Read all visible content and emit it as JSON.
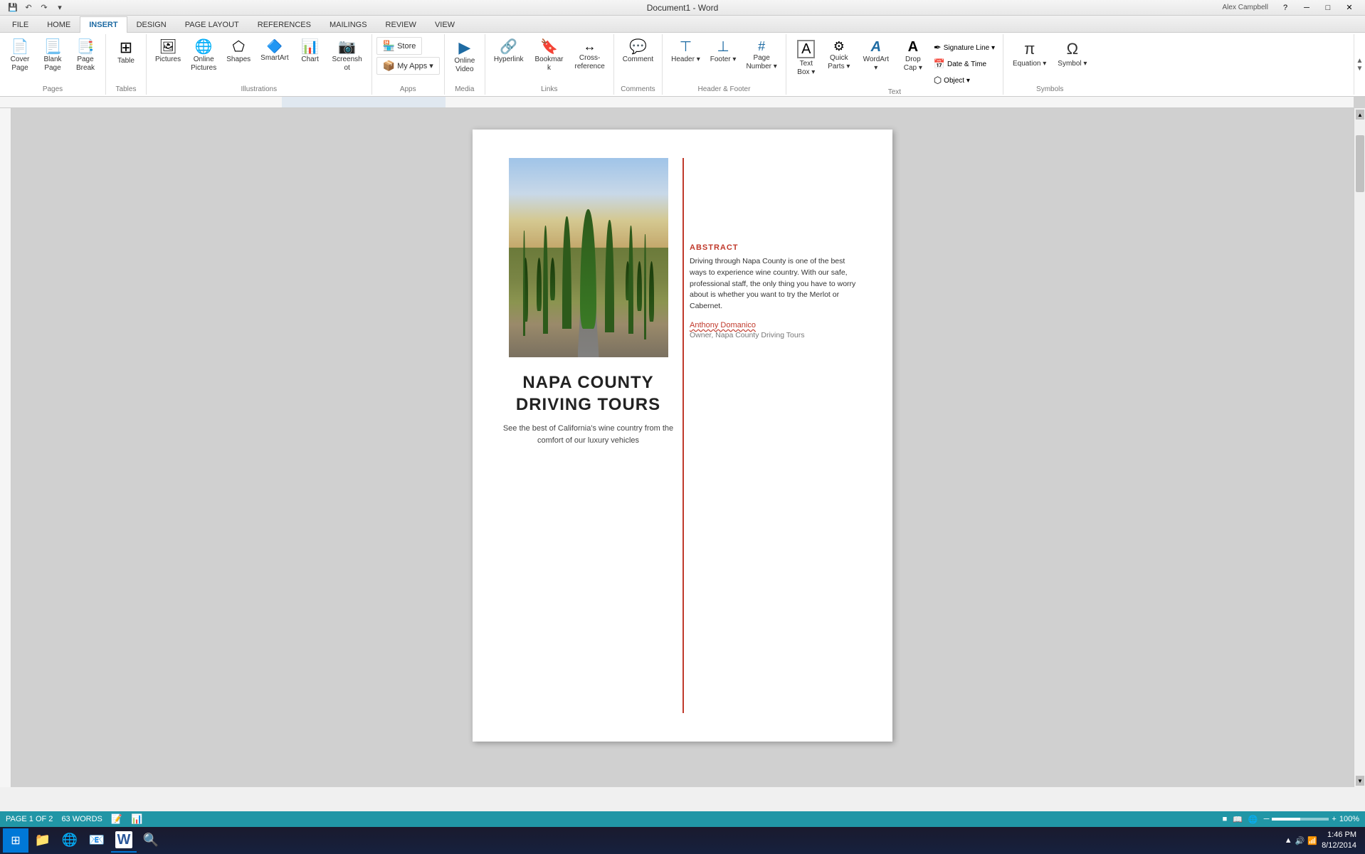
{
  "titlebar": {
    "title": "Document1 - Word",
    "minimize": "─",
    "maximize": "□",
    "close": "✕",
    "user": "Alex Campbell"
  },
  "qat": {
    "save": "💾",
    "undo": "↶",
    "redo": "↷",
    "more": "▾"
  },
  "tabs": [
    {
      "label": "FILE",
      "active": false
    },
    {
      "label": "HOME",
      "active": false
    },
    {
      "label": "INSERT",
      "active": true
    },
    {
      "label": "DESIGN",
      "active": false
    },
    {
      "label": "PAGE LAYOUT",
      "active": false
    },
    {
      "label": "REFERENCES",
      "active": false
    },
    {
      "label": "MAILINGS",
      "active": false
    },
    {
      "label": "REVIEW",
      "active": false
    },
    {
      "label": "VIEW",
      "active": false
    }
  ],
  "ribbon": {
    "groups": {
      "pages": {
        "label": "Pages",
        "buttons": [
          {
            "id": "cover-page",
            "icon": "📄",
            "label": "Cover\nPage"
          },
          {
            "id": "blank-page",
            "icon": "📃",
            "label": "Blank\nPage"
          },
          {
            "id": "page-break",
            "icon": "📑",
            "label": "Page\nBreak"
          }
        ]
      },
      "tables": {
        "label": "Tables",
        "buttons": [
          {
            "id": "table",
            "icon": "⊞",
            "label": "Table"
          }
        ]
      },
      "illustrations": {
        "label": "Illustrations",
        "buttons": [
          {
            "id": "pictures",
            "icon": "🖼",
            "label": "Pictures"
          },
          {
            "id": "online-pictures",
            "icon": "🌐",
            "label": "Online\nPictures"
          },
          {
            "id": "shapes",
            "icon": "⬠",
            "label": "Shapes"
          },
          {
            "id": "smartart",
            "icon": "🔷",
            "label": "SmartArt"
          },
          {
            "id": "chart",
            "icon": "📊",
            "label": "Chart"
          },
          {
            "id": "screenshot",
            "icon": "📷",
            "label": "Screenshot"
          }
        ]
      },
      "apps": {
        "label": "Apps",
        "buttons": [
          {
            "id": "store",
            "label": "🏪 Store"
          },
          {
            "id": "my-apps",
            "label": "📦 My Apps ▾"
          }
        ]
      },
      "media": {
        "label": "Media",
        "buttons": [
          {
            "id": "online-video",
            "icon": "▶",
            "label": "Online\nVideo"
          }
        ]
      },
      "links": {
        "label": "Links",
        "buttons": [
          {
            "id": "hyperlink",
            "icon": "🔗",
            "label": "Hyperlink"
          },
          {
            "id": "bookmark",
            "icon": "🔖",
            "label": "Bookmark"
          },
          {
            "id": "cross-reference",
            "icon": "↔",
            "label": "Cross-\nreference"
          }
        ]
      },
      "comments": {
        "label": "Comments",
        "buttons": [
          {
            "id": "comment",
            "icon": "💬",
            "label": "Comment"
          }
        ]
      },
      "header-footer": {
        "label": "Header & Footer",
        "buttons": [
          {
            "id": "header",
            "icon": "⬆",
            "label": "Header"
          },
          {
            "id": "footer",
            "icon": "⬇",
            "label": "Footer"
          },
          {
            "id": "page-number",
            "icon": "#",
            "label": "Page\nNumber"
          }
        ]
      },
      "text": {
        "label": "Text",
        "buttons": [
          {
            "id": "text-box",
            "icon": "A",
            "label": "Text\nBox ▾"
          },
          {
            "id": "quick-parts",
            "icon": "⚙",
            "label": "Quick\nParts ▾"
          },
          {
            "id": "wordart",
            "icon": "A",
            "label": "WordArt ▾"
          },
          {
            "id": "drop-cap",
            "icon": "A",
            "label": "Drop\nCap ▾"
          }
        ],
        "small_buttons": [
          {
            "id": "signature-line",
            "icon": "✒",
            "label": "Signature Line ▾"
          },
          {
            "id": "date-time",
            "icon": "📅",
            "label": "Date & Time"
          },
          {
            "id": "object",
            "icon": "⬡",
            "label": "Object ▾"
          }
        ]
      },
      "symbols": {
        "label": "Symbols",
        "buttons": [
          {
            "id": "equation",
            "icon": "π",
            "label": "Equation ▾"
          },
          {
            "id": "symbol",
            "icon": "Ω",
            "label": "Symbol ▾"
          }
        ]
      }
    }
  },
  "document": {
    "title_line1": "NAPA COUNTY",
    "title_line2": "DRIVING TOURS",
    "subtitle": "See the best of California's wine country from the\ncomfort of our luxury vehicles",
    "abstract_label": "ABSTRACT",
    "abstract_text": "Driving through Napa County is one of the best ways to experience wine country. With our safe, professional staff, the only thing you have to worry about is whether you want to try the Merlot or Cabernet.",
    "author_name": "Anthony Domanico",
    "author_title": "Owner, Napa County Driving Tours"
  },
  "statusbar": {
    "page_info": "PAGE 1 OF 2",
    "word_count": "63 WORDS",
    "layout_normal": "■",
    "layout_reading": "📖",
    "layout_web": "🌐",
    "zoom_level": "100%",
    "zoom_minus": "-",
    "zoom_plus": "+"
  },
  "taskbar": {
    "start_icon": "⊞",
    "items": [
      {
        "id": "file-explorer",
        "icon": "📁"
      },
      {
        "id": "chrome",
        "icon": "🌐"
      },
      {
        "id": "outlook",
        "icon": "📧"
      },
      {
        "id": "word",
        "icon": "W"
      },
      {
        "id": "search",
        "icon": "🔍"
      }
    ],
    "time": "1:46 PM",
    "date": "8/12/2014",
    "notifications": "▲",
    "volume": "🔊",
    "network": "📶"
  }
}
